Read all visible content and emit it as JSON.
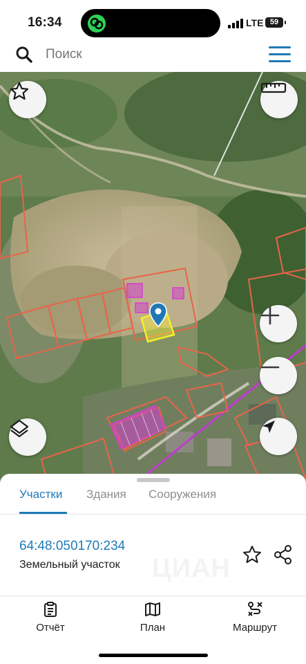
{
  "status_bar": {
    "time": "16:34",
    "network": "LTE",
    "battery": "59"
  },
  "search": {
    "placeholder": "Поиск"
  },
  "map": {
    "buttons": [
      "favorites-star",
      "ruler",
      "zoom-in",
      "zoom-out",
      "layers",
      "my-location"
    ],
    "colors": {
      "parcel_border": "#e8644a",
      "selected_parcel": "#f0ec3a",
      "building": "#d33fd0",
      "pin": "#1f78b4",
      "boundary": "#c03ad0"
    }
  },
  "tabs": [
    {
      "label": "Участки",
      "active": true
    },
    {
      "label": "Здания",
      "active": false
    },
    {
      "label": "Сооружения",
      "active": false
    }
  ],
  "result": {
    "cadastral_number": "64:48:050170:234",
    "type": "Земельный участок",
    "watermark": "ЦИАН"
  },
  "actions": [
    {
      "label": "Отчёт",
      "icon": "clipboard-icon"
    },
    {
      "label": "План",
      "icon": "map-icon"
    },
    {
      "label": "Маршрут",
      "icon": "route-icon"
    }
  ],
  "accent_color": "#1f7ab8"
}
